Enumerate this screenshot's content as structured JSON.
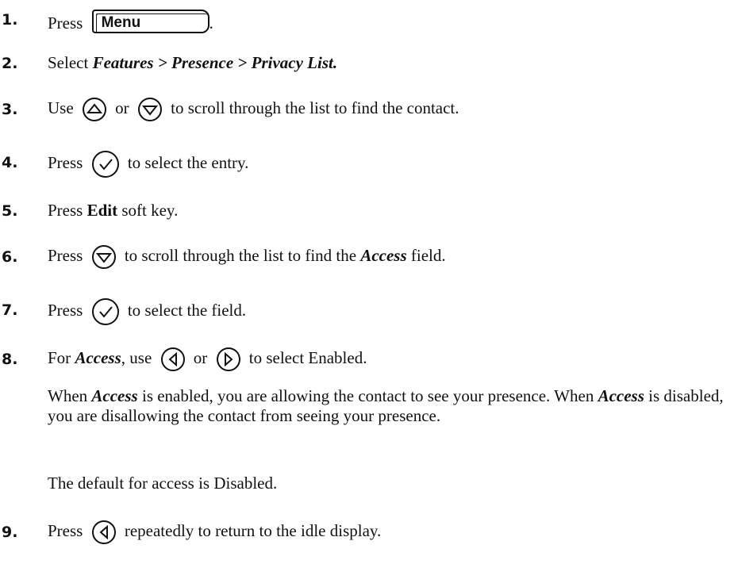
{
  "steps": [
    {
      "num": "1.",
      "pre": "Press",
      "key_label": "Menu",
      "post": "."
    },
    {
      "num": "2.",
      "pre": "Select",
      "path": "Features > Presence > Privacy List."
    },
    {
      "num": "3.",
      "pre": "Use",
      "mid": "or",
      "post": "to scroll through the list to find the contact.",
      "icons": [
        "up-arrow-icon",
        "down-arrow-icon"
      ]
    },
    {
      "num": "4.",
      "pre": "Press",
      "post": "to select the entry.",
      "icons": [
        "select-check-icon"
      ]
    },
    {
      "num": "5.",
      "pre": "Press",
      "bold": "Edit",
      "post": "soft key."
    },
    {
      "num": "6.",
      "pre": "Press",
      "post_a": "to scroll through the list to find the",
      "field": "Access",
      "post_b": "field.",
      "icons": [
        "down-arrow-icon"
      ]
    },
    {
      "num": "7.",
      "pre": "Press",
      "post": "to select the field.",
      "icons": [
        "select-check-icon"
      ]
    },
    {
      "num": "8.",
      "pre": "For",
      "field": "Access",
      "comma_use": ", use",
      "mid": "or",
      "post": "to select Enabled.",
      "icons": [
        "left-arrow-icon",
        "right-arrow-icon"
      ]
    },
    {
      "num": "9.",
      "pre": "Press",
      "post": "repeatedly to return to the idle display.",
      "icons": [
        "left-arrow-icon"
      ]
    }
  ],
  "notes": {
    "when1": "When",
    "access1": "Access",
    "enabled_text": "is enabled, you are allowing the contact to see your presence.",
    "when2": "When",
    "access2": "Access",
    "disabled_text": "is disabled, you are disallowing the contact from seeing your presence.",
    "default_text": "The default for access is Disabled."
  }
}
